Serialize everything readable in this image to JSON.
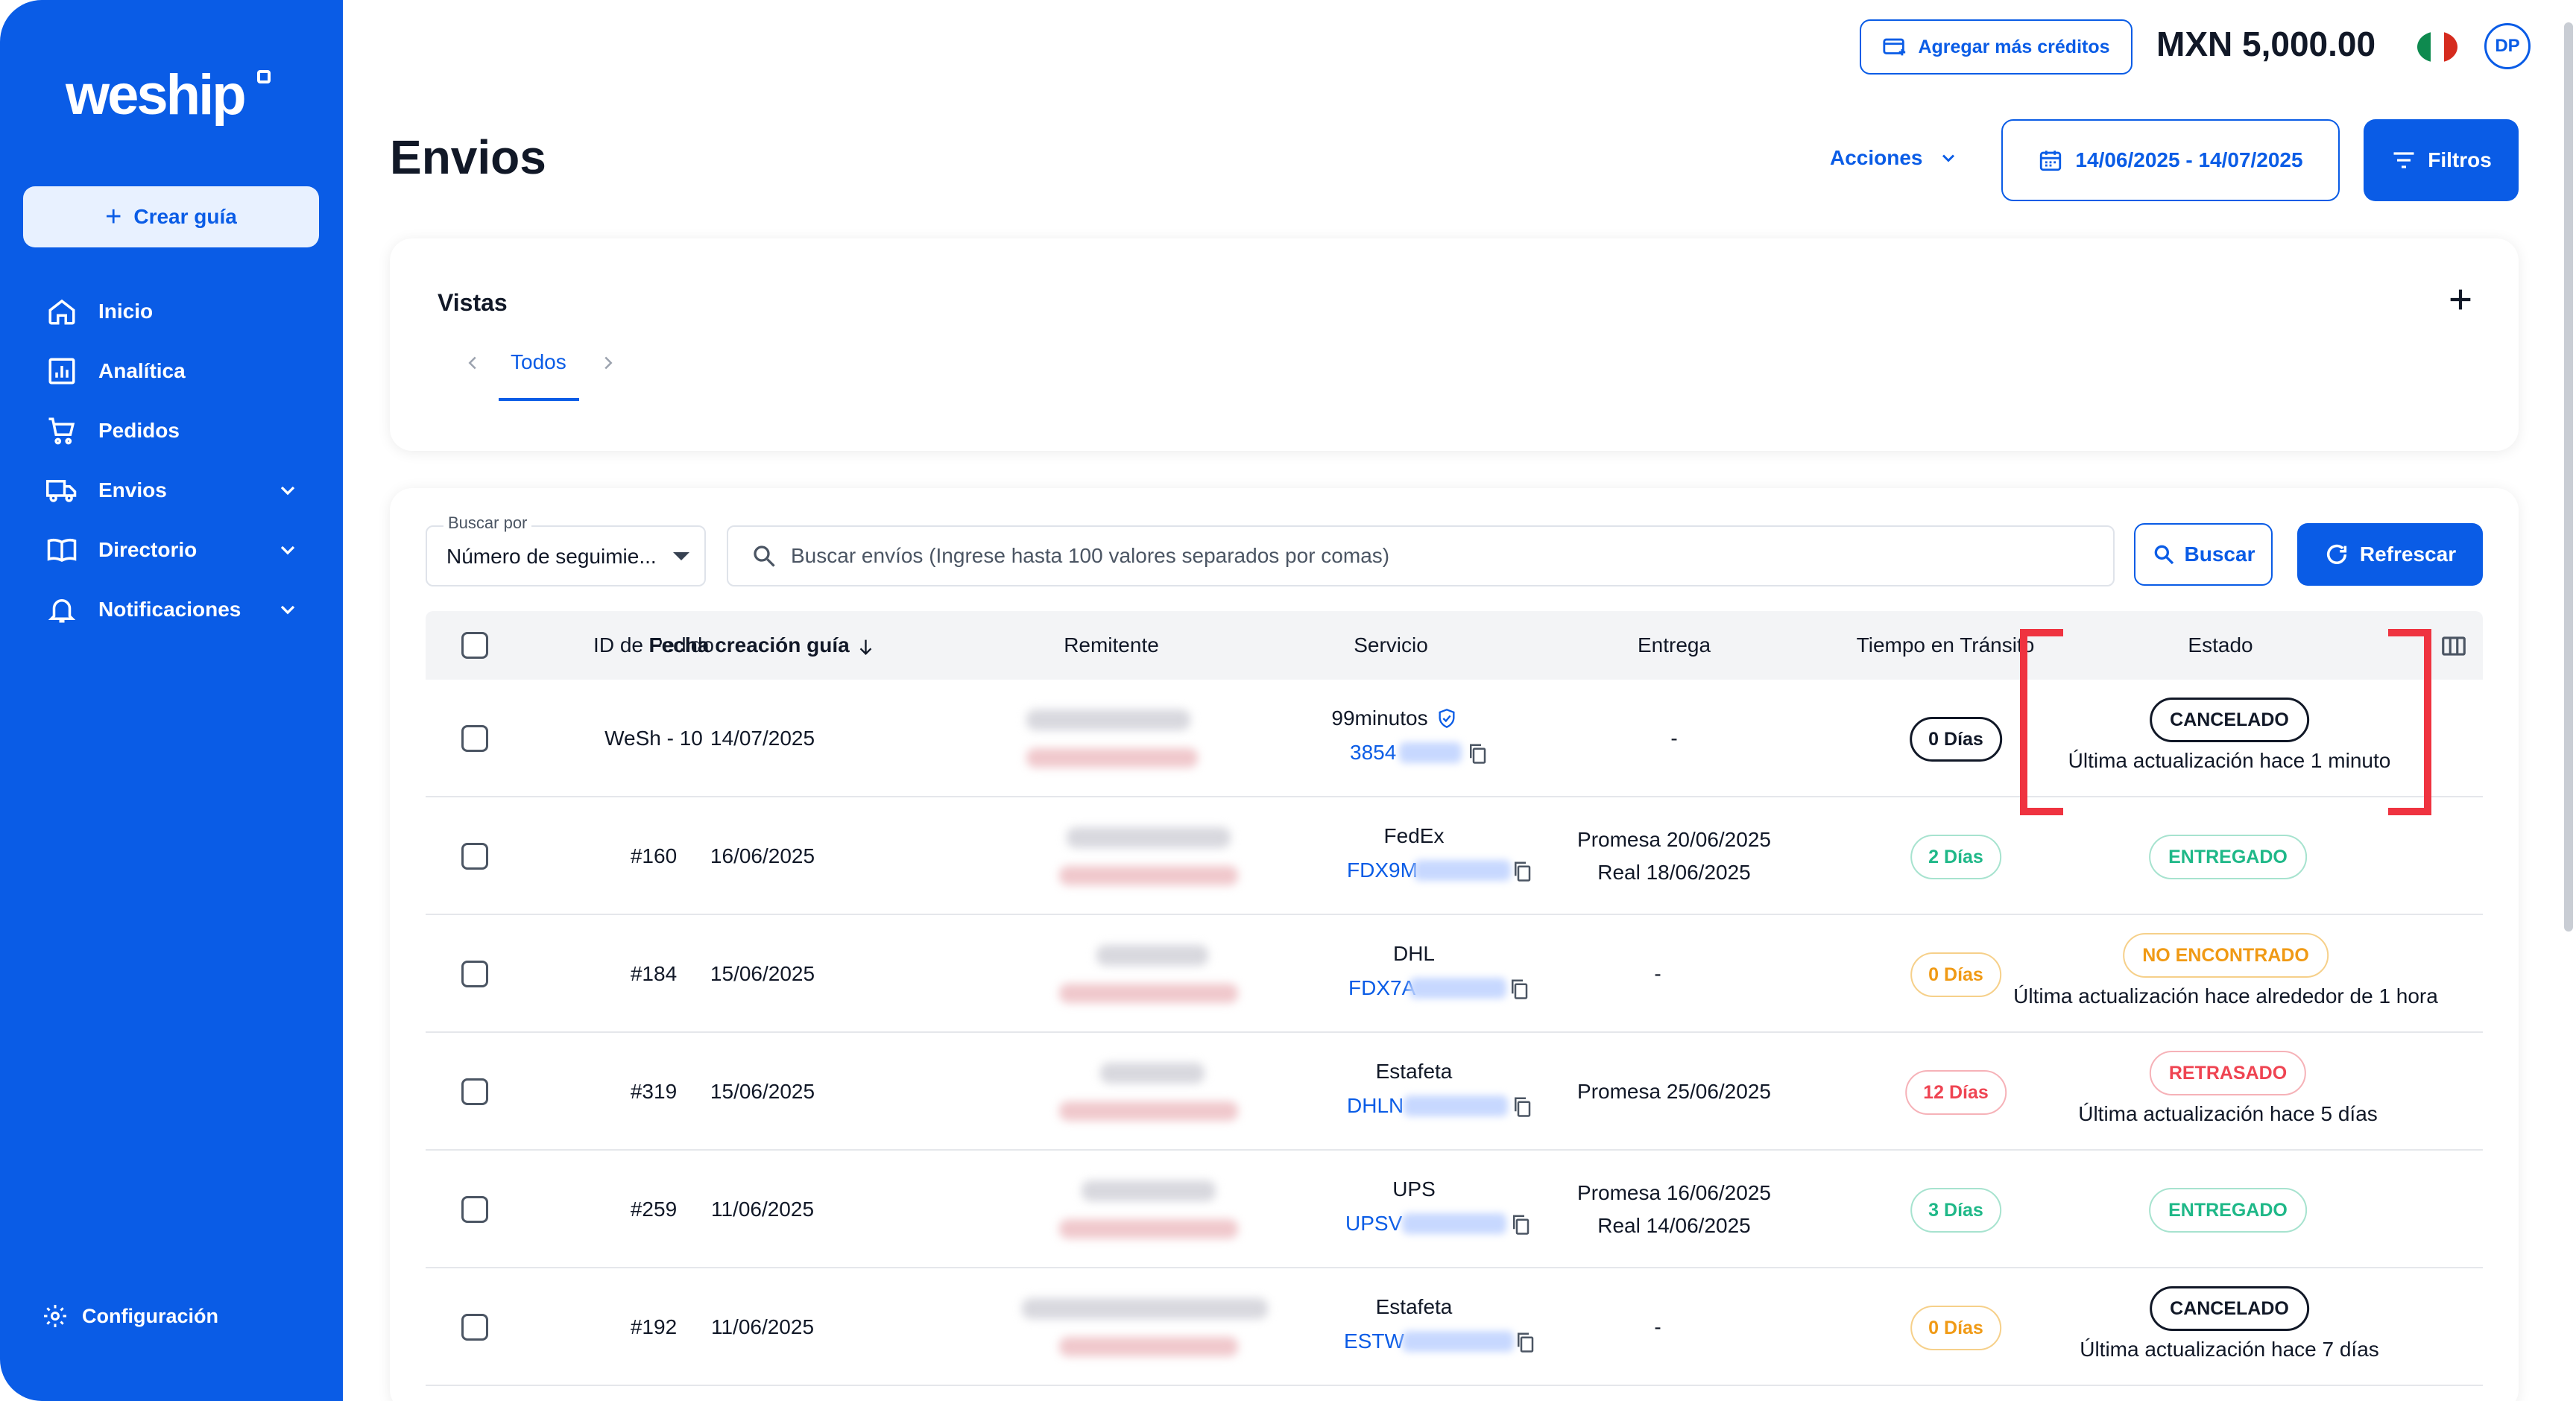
{
  "sidebar": {
    "logo": "weship",
    "create_label": "Crear guía",
    "items": [
      {
        "label": "Inicio",
        "icon": "home-icon"
      },
      {
        "label": "Analítica",
        "icon": "analytics-icon"
      },
      {
        "label": "Pedidos",
        "icon": "cart-icon"
      },
      {
        "label": "Envios",
        "icon": "truck-icon",
        "expandable": true
      },
      {
        "label": "Directorio",
        "icon": "book-icon",
        "expandable": true
      },
      {
        "label": "Notificaciones",
        "icon": "bell-icon",
        "expandable": true
      }
    ],
    "settings_label": "Configuración"
  },
  "topbar": {
    "credits_label": "Agregar más créditos",
    "balance": "MXN 5,000.00",
    "avatar_initials": "DP"
  },
  "header": {
    "title": "Envios",
    "actions_label": "Acciones",
    "date_range": "14/06/2025 - 14/07/2025",
    "filters_label": "Filtros"
  },
  "vistas": {
    "title": "Vistas",
    "tabs": [
      {
        "label": "Todos",
        "active": true
      }
    ]
  },
  "search": {
    "by_label": "Buscar por",
    "by_value": "Número de seguimie...",
    "placeholder": "Buscar envíos (Ingrese hasta 100 valores separados por comas)",
    "search_label": "Buscar",
    "refresh_label": "Refrescar"
  },
  "table": {
    "columns": [
      "ID de Pedido",
      "Fecha creación guía",
      "Remitente",
      "Servicio",
      "Entrega",
      "Tiempo en Tránsito",
      "Estado"
    ],
    "rows": [
      {
        "id": "WeSh - 10",
        "date": "14/07/2025",
        "service": "99minutos",
        "tracking": "3854",
        "delivery": [
          "-"
        ],
        "transit": "0 Días",
        "status": "CANCELADO",
        "status_detail": "Última actualización hace 1 minuto"
      },
      {
        "id": "#160",
        "date": "16/06/2025",
        "service": "FedEx",
        "tracking": "FDX9M",
        "delivery": [
          "Promesa 20/06/2025",
          "Real 18/06/2025"
        ],
        "transit": "2 Días",
        "status": "ENTREGADO",
        "status_detail": ""
      },
      {
        "id": "#184",
        "date": "15/06/2025",
        "service": "DHL",
        "tracking": "FDX7A",
        "delivery": [
          "-"
        ],
        "transit": "0 Días",
        "status": "NO ENCONTRADO",
        "status_detail": "Última actualización hace alrededor de 1 hora"
      },
      {
        "id": "#319",
        "date": "15/06/2025",
        "service": "Estafeta",
        "tracking": "DHLN",
        "delivery": [
          "Promesa 25/06/2025"
        ],
        "transit": "12 Días",
        "status": "RETRASADO",
        "status_detail": "Última actualización hace 5 días"
      },
      {
        "id": "#259",
        "date": "11/06/2025",
        "service": "UPS",
        "tracking": "UPSV",
        "delivery": [
          "Promesa 16/06/2025",
          "Real 14/06/2025"
        ],
        "transit": "3 Días",
        "status": "ENTREGADO",
        "status_detail": ""
      },
      {
        "id": "#192",
        "date": "11/06/2025",
        "service": "Estafeta",
        "tracking": "ESTW",
        "delivery": [
          "-"
        ],
        "transit": "0 Días",
        "status": "CANCELADO",
        "status_detail": "Última actualización hace 7 días"
      }
    ]
  },
  "colors": {
    "primary": "#0a5ce6",
    "green": "#1fb888",
    "orange": "#f09a15",
    "red": "#ef4452",
    "highlight": "#ef3340"
  }
}
